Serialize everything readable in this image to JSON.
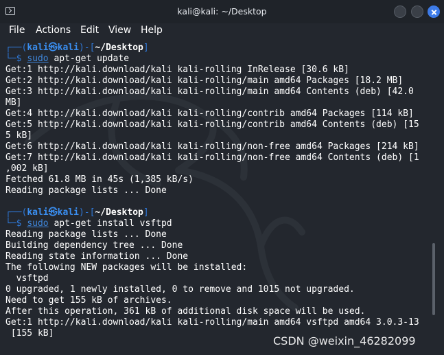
{
  "window": {
    "title": "kali@kali: ~/Desktop"
  },
  "menu": [
    "File",
    "Actions",
    "Edit",
    "View",
    "Help"
  ],
  "prompts": [
    {
      "frame_open": "┌──(",
      "user": "kali㉿kali",
      "frame_mid": ")-[",
      "dir": "~/Desktop",
      "frame_close": "]",
      "arrow": "└─$ ",
      "sudo": "sudo",
      "command": " apt-get update"
    },
    {
      "frame_open": "┌──(",
      "user": "kali㉿kali",
      "frame_mid": ")-[",
      "dir": "~/Desktop",
      "frame_close": "]",
      "arrow": "└─$ ",
      "sudo": "sudo",
      "command": " apt-get install vsftpd"
    }
  ],
  "output1": [
    "Get:1 http://kali.download/kali kali-rolling InRelease [30.6 kB]",
    "Get:2 http://kali.download/kali kali-rolling/main amd64 Packages [18.2 MB]",
    "Get:3 http://kali.download/kali kali-rolling/main amd64 Contents (deb) [42.0",
    "MB]",
    "Get:4 http://kali.download/kali kali-rolling/contrib amd64 Packages [114 kB]",
    "Get:5 http://kali.download/kali kali-rolling/contrib amd64 Contents (deb) [15",
    "5 kB]",
    "Get:6 http://kali.download/kali kali-rolling/non-free amd64 Packages [214 kB]",
    "Get:7 http://kali.download/kali kali-rolling/non-free amd64 Contents (deb) [1",
    ",002 kB]",
    "Fetched 61.8 MB in 45s (1,385 kB/s)",
    "Reading package lists ... Done",
    ""
  ],
  "output2": [
    "Reading package lists ... Done",
    "Building dependency tree ... Done",
    "Reading state information ... Done",
    "The following NEW packages will be installed:",
    "  vsftpd",
    "0 upgraded, 1 newly installed, 0 to remove and 1015 not upgraded.",
    "Need to get 155 kB of archives.",
    "After this operation, 361 kB of additional disk space will be used.",
    "Get:1 http://kali.download/kali kali-rolling/main amd64 vsftpd amd64 3.0.3-13",
    " [155 kB]"
  ],
  "watermark": "CSDN @weixin_46282099",
  "colors": {
    "background": "#23272e",
    "prompt_frame": "#2f79d8",
    "prompt_user": "#3a8ef0",
    "text": "#ffffff",
    "close_button": "#3d7be8"
  }
}
